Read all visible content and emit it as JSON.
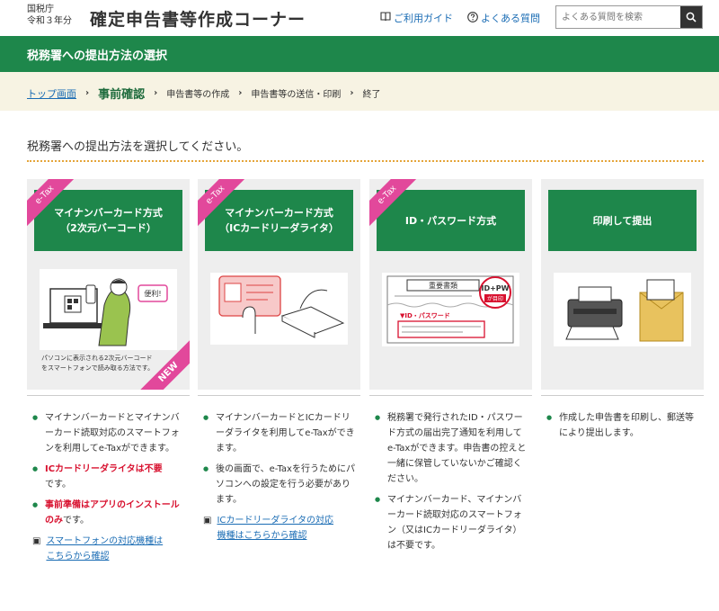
{
  "header": {
    "agency": "国税庁",
    "year": "令和３年分",
    "title": "確定申告書等作成コーナー",
    "guide_link": "ご利用ガイド",
    "faq_link": "よくある質問",
    "search_placeholder": "よくある質問を検索"
  },
  "band_title": "税務署への提出方法の選択",
  "breadcrumb": {
    "top": "トップ画面",
    "current": "事前確認",
    "steps": [
      "申告書等の作成",
      "申告書等の送信・印刷",
      "終了"
    ]
  },
  "lead": "税務署への提出方法を選択してください。",
  "cards": [
    {
      "ribbon": "e-Tax",
      "label_line1": "マイナンバーカード方式",
      "label_line2": "（2次元バーコード）",
      "caption_line1": "パソコンに表示される2次元バーコード",
      "caption_line2": "をスマートフォンで読み取る方法です。",
      "new_badge": "NEW"
    },
    {
      "ribbon": "e-Tax",
      "label_line1": "マイナンバーカード方式",
      "label_line2": "（ICカードリーダライタ）"
    },
    {
      "ribbon": "e-Tax",
      "label_line1": "ID・パスワード方式",
      "pic_title": "重要書類",
      "pic_badge": "ID+PW",
      "pic_badge_sub": "が目印",
      "pic_label": "▼ID・パスワード"
    },
    {
      "label_line1": "印刷して提出"
    }
  ],
  "col1": {
    "items": [
      {
        "text": "マイナンバーカードとマイナンバーカード読取対応のスマートフォンを利用してe-Taxができます。"
      },
      {
        "red": "ICカードリーダライタは不要",
        "text": "です。"
      },
      {
        "red": "事前準備はアプリのインストールのみ",
        "text": "です。"
      }
    ],
    "link_line1": "スマートフォンの対応機種は",
    "link_line2": "こちらから確認"
  },
  "col2": {
    "items": [
      "マイナンバーカードとICカードリーダライタを利用してe-Taxができます。",
      "後の画面で、e-Taxを行うためにパソコンへの設定を行う必要があります。"
    ],
    "link_line1": "ICカードリーダライタの対応",
    "link_line2": "機種はこちらから確認"
  },
  "col3": {
    "items": [
      "税務署で発行されたID・パスワード方式の届出完了通知を利用してe-Taxができます。申告書の控えと一緒に保管していないかご確認ください。",
      "マイナンバーカード、マイナンバーカード読取対応のスマートフォン（又はICカードリーダライタ）は不要です。"
    ]
  },
  "col4": {
    "items": [
      "作成した申告書を印刷し、郵送等により提出します。"
    ]
  },
  "icons": {
    "guide": "book-icon",
    "faq": "question-icon",
    "search": "search-icon",
    "link": "window-icon"
  },
  "colors": {
    "green": "#1e874b",
    "pink": "#e2489b",
    "red": "#d8112f",
    "link": "#1a6cb4",
    "cream": "#f7f3e3"
  }
}
